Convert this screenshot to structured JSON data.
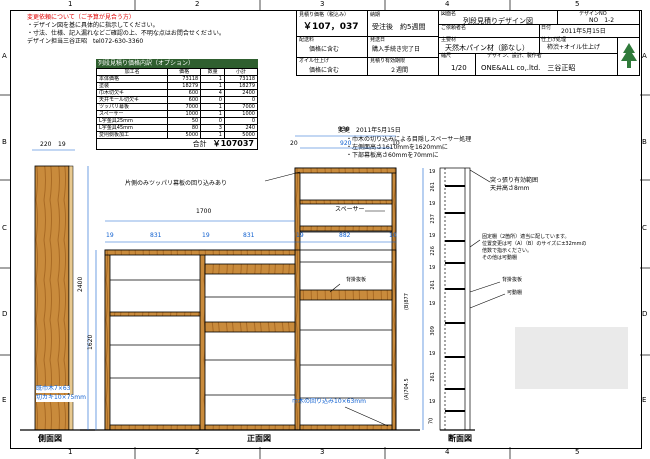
{
  "grid": {
    "cols": [
      "1",
      "2",
      "3",
      "4",
      "5"
    ],
    "rows": [
      "A",
      "B",
      "C",
      "D",
      "E"
    ]
  },
  "notes": {
    "title": "変更依頼について（ご予算が見合う方）",
    "lines": [
      "・デザイン図を基に具体的に指示してください。",
      "・寸法、仕様、記入漏れなどご確認の上、不明な点はお問合せください。",
      "デザイン担当三谷正昭　tel072-630-3360"
    ]
  },
  "estimate": {
    "title": "列段見積り価格内訳（オプション）",
    "headers": [
      "加工名",
      "価格",
      "数量",
      "小計"
    ],
    "rows": [
      [
        "本体価格",
        "73118",
        "1",
        "73118"
      ],
      [
        "塗装",
        "18279",
        "1",
        "18279"
      ],
      [
        "巾木切欠キ",
        "600",
        "4",
        "2400"
      ],
      [
        "天井モール切欠キ",
        "600",
        "0",
        "0"
      ],
      [
        "ツッパリ幕板",
        "7000",
        "1",
        "7000"
      ],
      [
        "スペーサー",
        "1000",
        "1",
        "1000"
      ],
      [
        "L字金具25mm",
        "50",
        "0",
        "0"
      ],
      [
        "L字金具45mm",
        "80",
        "3",
        "240"
      ],
      [
        "変則側板加工",
        "5000",
        "1",
        "5000"
      ]
    ],
    "total_label": "合計",
    "total_value": "￥107037"
  },
  "titleblock": {
    "price_label": "見積り価格（税込み）",
    "price_value": "￥107，037",
    "delivery_label": "配送料",
    "delivery_value": "価格に含む",
    "oil_label": "オイル仕上げ",
    "oil_value": "価格に含む",
    "lead_label": "納期",
    "lead_value": "受注後　約5週間",
    "date_label": "発送日",
    "date_value": "購入手続き完了日",
    "valid_label": "見積り有効期限",
    "valid_value": "２週間",
    "design_name_label": "図面名",
    "design_name": "列段見積りデザイン図",
    "design_no_label": "デザインNO",
    "design_no": "NO　1-2",
    "customer_label": "ご依頼者名",
    "date2_label": "日付",
    "date2": "2011年5月15日",
    "material_label": "主要材",
    "material": "天然木パイン材（節なし）",
    "finish_label": "仕上げ処理",
    "finish": "柿渋+オイル仕上げ",
    "scale_label": "縮尺",
    "scale": "1/20",
    "maker_label": "デザイン、設計、製作者",
    "maker": "ONE&ALL co,.ltd.　三谷正昭"
  },
  "change_note": {
    "title": "変更　2011年5月15日",
    "lines": [
      "・巾木の切り込みによる目隠しスペーサー処理",
      "・左側面高さ1610mmを1620mmに",
      "・下部幕板高さ60mmを70mmに"
    ]
  },
  "drawing": {
    "dim_930": "930",
    "dim_920": "920",
    "dim_20": "20",
    "dim_10": "10",
    "dim_220": "220",
    "dim_19": "19",
    "dim_1700": "1700",
    "dims_top": [
      "19",
      "831",
      "19",
      "831",
      "19",
      "882",
      "10"
    ],
    "dim_2400": "2400",
    "dim_1620": "1620",
    "label_tsuppari": "片側のみツッパリ幕板の回り込みあり",
    "label_spacer": "スペーサー",
    "label_backboard": "背掛抜板",
    "label_habaki_left": "既巾木7×63",
    "label_habaki_left2": "切カキ10×75mm",
    "label_habaki_right": "巾木の回り込み10×63mm",
    "side_dims": [
      "19",
      "261",
      "19",
      "237",
      "19",
      "226",
      "19",
      "261",
      "19",
      "309",
      "19",
      "261",
      "19",
      "70"
    ],
    "vert_dim1": "(B)877",
    "vert_dim2": "(A)704.5",
    "sec_note1": "突っ張り有効範囲",
    "sec_note2": "天井高さ8mm",
    "sec_note3": "固定棚（2箇所）適当に配しています。",
    "sec_note4": "位置変更は可（A）（B）のサイズに±32mmの",
    "sec_note5": "倍数で指示ください。",
    "sec_note6": "その他は可動棚",
    "sec_note7": "背掛抜板",
    "sec_note8": "可動棚",
    "view_side": "側面図",
    "view_front": "正面図",
    "view_section": "断面図"
  }
}
